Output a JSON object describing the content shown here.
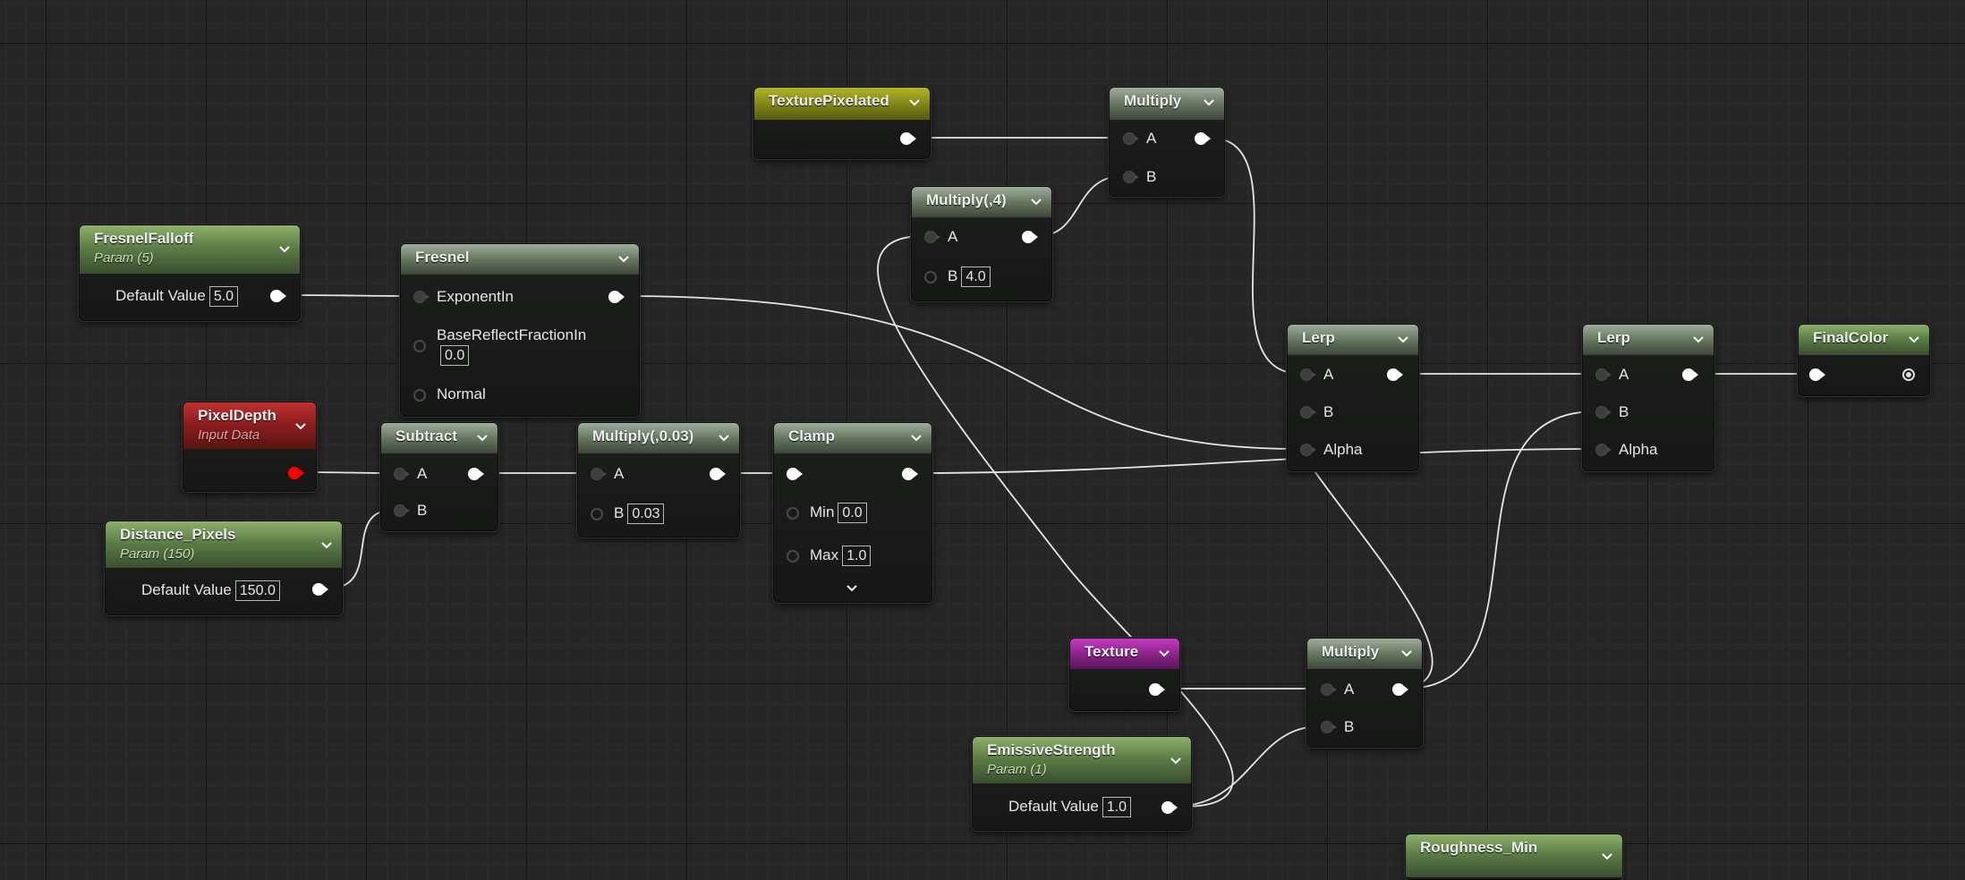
{
  "nodes": {
    "texture_pixelated": {
      "title": "TexturePixelated"
    },
    "multiply_top": {
      "title": "Multiply",
      "pin_a": "A",
      "pin_b": "B"
    },
    "multiply_4": {
      "title": "Multiply(,4)",
      "pin_a": "A",
      "pin_b": "B",
      "b_value": "4.0"
    },
    "fresnel_falloff": {
      "title": "FresnelFalloff",
      "subtitle": "Param (5)",
      "default_label": "Default Value",
      "default_value": "5.0"
    },
    "fresnel": {
      "title": "Fresnel",
      "exponent_in": "ExponentIn",
      "base_reflect": "BaseReflectFractionIn",
      "base_reflect_value": "0.0",
      "normal": "Normal"
    },
    "pixel_depth": {
      "title": "PixelDepth",
      "subtitle": "Input Data"
    },
    "subtract": {
      "title": "Subtract",
      "pin_a": "A",
      "pin_b": "B"
    },
    "distance_pixels": {
      "title": "Distance_Pixels",
      "subtitle": "Param (150)",
      "default_label": "Default Value",
      "default_value": "150.0"
    },
    "multiply_003": {
      "title": "Multiply(,0.03)",
      "pin_a": "A",
      "pin_b": "B",
      "b_value": "0.03"
    },
    "clamp": {
      "title": "Clamp",
      "min_label": "Min",
      "min_value": "0.0",
      "max_label": "Max",
      "max_value": "1.0"
    },
    "lerp_1": {
      "title": "Lerp",
      "pin_a": "A",
      "pin_b": "B",
      "pin_alpha": "Alpha"
    },
    "lerp_2": {
      "title": "Lerp",
      "pin_a": "A",
      "pin_b": "B",
      "pin_alpha": "Alpha"
    },
    "final_color": {
      "title": "FinalColor"
    },
    "texture": {
      "title": "Texture"
    },
    "multiply_bottom": {
      "title": "Multiply",
      "pin_a": "A",
      "pin_b": "B"
    },
    "emissive_strength": {
      "title": "EmissiveStrength",
      "subtitle": "Param (1)",
      "default_label": "Default Value",
      "default_value": "1.0"
    },
    "roughness_min": {
      "title": "Roughness_Min"
    }
  },
  "colors": {
    "background": "#262626",
    "wire": "#e6e6e6",
    "param_header": "#5c7e47",
    "math_header": "#66765f",
    "texture_object_header": "#838719",
    "input_data_header": "#8a1e1e",
    "texture_header": "#8c248c",
    "pixel_depth_pin": "#ff0000"
  },
  "icons": [
    "chevron-down-icon",
    "input-pin-icon",
    "output-pin-icon",
    "result-pin-icon"
  ]
}
